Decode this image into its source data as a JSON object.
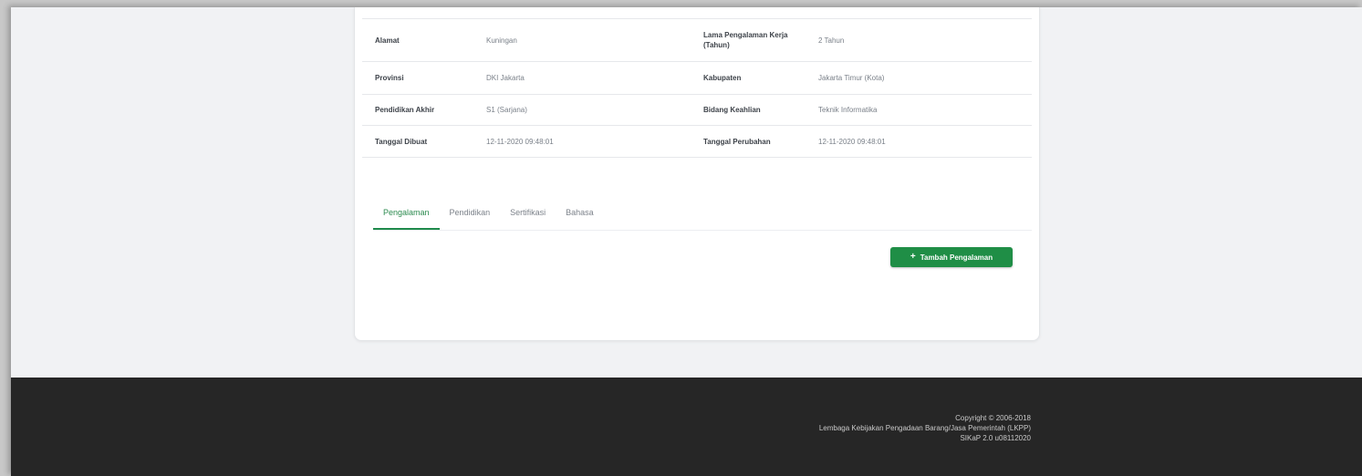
{
  "info": {
    "rows": [
      {
        "label1": "Alamat",
        "value1": "Kuningan",
        "label2": "Lama Pengalaman Kerja (Tahun)",
        "value2": "2 Tahun"
      },
      {
        "label1": "Provinsi",
        "value1": "DKI Jakarta",
        "label2": "Kabupaten",
        "value2": "Jakarta Timur (Kota)"
      },
      {
        "label1": "Pendidikan Akhir",
        "value1": "S1 (Sarjana)",
        "label2": "Bidang Keahlian",
        "value2": "Teknik Informatika"
      },
      {
        "label1": "Tanggal Dibuat",
        "value1": "12-11-2020 09:48:01",
        "label2": "Tanggal Perubahan",
        "value2": "12-11-2020 09:48:01"
      }
    ]
  },
  "tabs": {
    "items": [
      {
        "label": "Pengalaman"
      },
      {
        "label": "Pendidikan"
      },
      {
        "label": "Sertifikasi"
      },
      {
        "label": "Bahasa"
      }
    ],
    "active_index": 0
  },
  "actions": {
    "add_label": "Tambah Pengalaman",
    "add_icon": "plus-icon"
  },
  "footer": {
    "copyright": "Copyright © 2006-2018",
    "org": "Lembaga Kebijakan Pengadaan Barang/Jasa Pemerintah (LKPP)",
    "version": "SIKaP 2.0 u08112020"
  },
  "colors": {
    "accent": "#1f8e46",
    "footer_bg": "#262626",
    "page_bg": "#f1f2f4"
  }
}
